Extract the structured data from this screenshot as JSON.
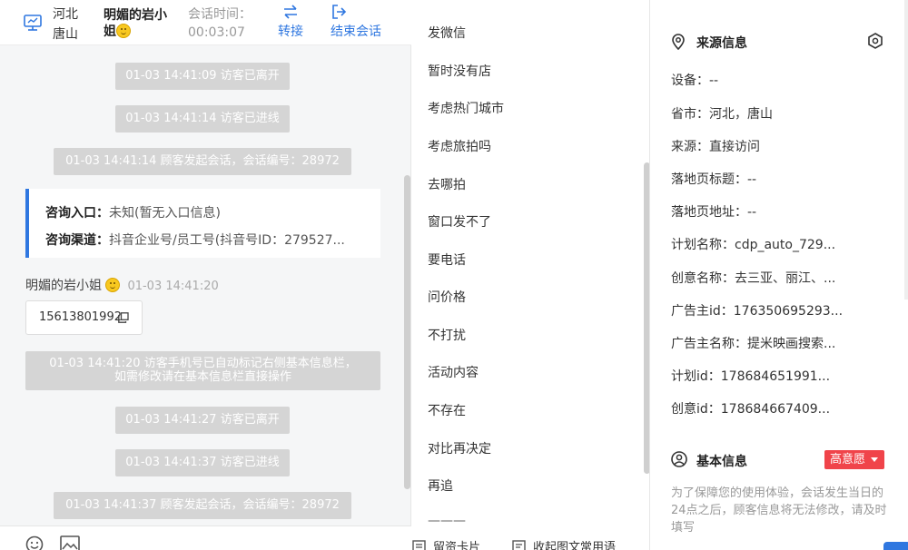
{
  "header": {
    "location_line1": "河北",
    "location_line2": "唐山",
    "visitor_name": "明媚的岩小姐",
    "session_time_label": "会话时间：",
    "session_time": "00:03:07",
    "transfer_label": "转接",
    "end_session_label": "结束会话"
  },
  "messages": {
    "sys1": "01-03 14:41:09 访客已离开",
    "sys2": "01-03 14:41:14 访客已进线",
    "sys3": "01-03 14:41:14 顾客发起会话，会话编号：28972",
    "card": {
      "entry_label": "咨询入口：",
      "entry_value": "未知(暂无入口信息)",
      "channel_label": "咨询渠道：",
      "channel_value": "抖音企业号/员工号(抖音号ID：279527..."
    },
    "sender_name": "明媚的岩小姐",
    "sender_time": "01-03 14:41:20",
    "phone": "15613801992",
    "sys4_line1": "01-03 14:41:20 访客手机号已自动标记右侧基本信息栏，",
    "sys4_line2": "如需修改请在基本信息栏直接操作",
    "sys5": "01-03 14:41:27 访客已离开",
    "sys6": "01-03 14:41:37 访客已进线",
    "sys7": "01-03 14:41:37 顾客发起会话，会话编号：28972"
  },
  "quick_replies": [
    "发微信",
    "暂时没有店",
    "考虑热门城市",
    "考虑旅拍吗",
    "去哪拍",
    "窗口发不了",
    "要电话",
    "问价格",
    "不打扰",
    "活动内容",
    "不存在",
    "对比再决定",
    "再追"
  ],
  "mid_footer": {
    "card_label": "留资卡片",
    "collect_label": "收起图文常用语"
  },
  "source_info": {
    "title": "来源信息",
    "fields": [
      "设备：--",
      "省市：河北，唐山",
      "来源：直接访问",
      "落地页标题：--",
      "落地页地址：--",
      "计划名称：cdp_auto_729...",
      "创意名称：去三亚、丽江、...",
      "广告主id：176350695293...",
      "广告主名称：提米映画搜索...",
      "计划id：178684651991...",
      "创意id：178684667409..."
    ]
  },
  "basic_info": {
    "title": "基本信息",
    "intent": "高意愿",
    "note": "为了保障您的使用体验，会话发生当日的24点之后，顾客信息将无法修改，请及时填写"
  },
  "colors": {
    "accent": "#2f77e0",
    "badge_red": "#f0444a",
    "sys_gray": "#d5d5d5"
  }
}
